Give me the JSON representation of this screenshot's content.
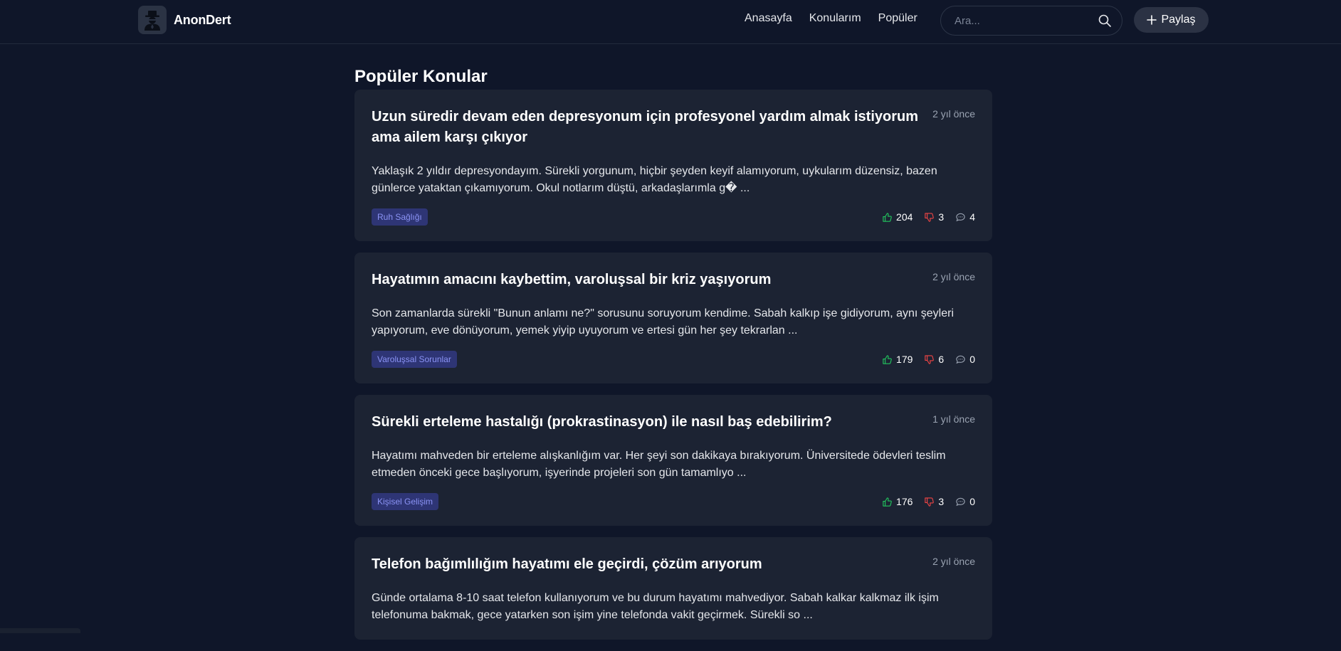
{
  "header": {
    "brand": "AnonDert",
    "nav": [
      "Anasayfa",
      "Konularım",
      "Popüler"
    ],
    "search_placeholder": "Ara...",
    "share_label": "Paylaş"
  },
  "page": {
    "title": "Popüler Konular"
  },
  "posts": [
    {
      "title": "Uzun süredir devam eden depresyonum için profesyonel yardım almak istiyorum ama ailem karşı çıkıyor",
      "time": "2 yıl önce",
      "excerpt": "Yaklaşık 2 yıldır depresyondayım. Sürekli yorgunum, hiçbir şeyden keyif alamıyorum, uykularım düzensiz, bazen günlerce yataktan çıkamıyorum. Okul notlarım düştü, arkadaşlarımla g� ...",
      "tag": "Ruh Sağlığı",
      "likes": "204",
      "dislikes": "3",
      "comments": "4"
    },
    {
      "title": "Hayatımın amacını kaybettim, varoluşsal bir kriz yaşıyorum",
      "time": "2 yıl önce",
      "excerpt": "Son zamanlarda sürekli \"Bunun anlamı ne?\" sorusunu soruyorum kendime. Sabah kalkıp işe gidiyorum, aynı şeyleri yapıyorum, eve dönüyorum, yemek yiyip uyuyorum ve ertesi gün her şey tekrarlan ...",
      "tag": "Varoluşsal Sorunlar",
      "likes": "179",
      "dislikes": "6",
      "comments": "0"
    },
    {
      "title": "Sürekli erteleme hastalığı (prokrastinasyon) ile nasıl baş edebilirim?",
      "time": "1 yıl önce",
      "excerpt": "Hayatımı mahveden bir erteleme alışkanlığım var. Her şeyi son dakikaya bırakıyorum. Üniversitede ödevleri teslim etmeden önceki gece başlıyorum, işyerinde projeleri son gün tamamlıyo ...",
      "tag": "Kişisel Gelişim",
      "likes": "176",
      "dislikes": "3",
      "comments": "0"
    },
    {
      "title": "Telefon bağımlılığım hayatımı ele geçirdi, çözüm arıyorum",
      "time": "2 yıl önce",
      "excerpt": "Günde ortalama 8-10 saat telefon kullanıyorum ve bu durum hayatımı mahvediyor. Sabah kalkar kalkmaz ilk işim telefonuma bakmak, gece yatarken son işim yine telefonda vakit geçirmek. Sürekli so ...",
      "tag": "",
      "likes": "",
      "dislikes": "",
      "comments": ""
    }
  ],
  "colors": {
    "background": "#0f1629",
    "card": "#1c2333",
    "like": "#22c55e",
    "dislike": "#ef4444",
    "tag_bg": "#2e3575",
    "tag_text": "#8b93f5"
  }
}
